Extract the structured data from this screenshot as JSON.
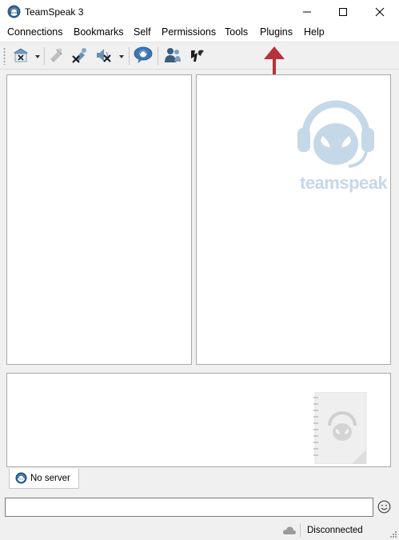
{
  "window": {
    "title": "TeamSpeak 3"
  },
  "menu": {
    "items": [
      "Connections",
      "Bookmarks",
      "Self",
      "Permissions",
      "Tools",
      "Plugins",
      "Help"
    ]
  },
  "watermark": {
    "text": "teamspeak"
  },
  "tabs": {
    "server_tab": "No server"
  },
  "status": {
    "connection": "Disconnected"
  },
  "colors": {
    "annotation_arrow": "#b5323c",
    "brand_light": "#c5d8e8",
    "icon_blue": "#2d6ea6"
  },
  "icons": [
    "teamspeak-app-icon",
    "connect-icon",
    "disconnect-icon",
    "away-icon",
    "mute-mic-icon",
    "mute-speaker-icon",
    "chat-icon",
    "contacts-icon",
    "whisper-icon",
    "smiley-icon",
    "cloud-icon"
  ]
}
